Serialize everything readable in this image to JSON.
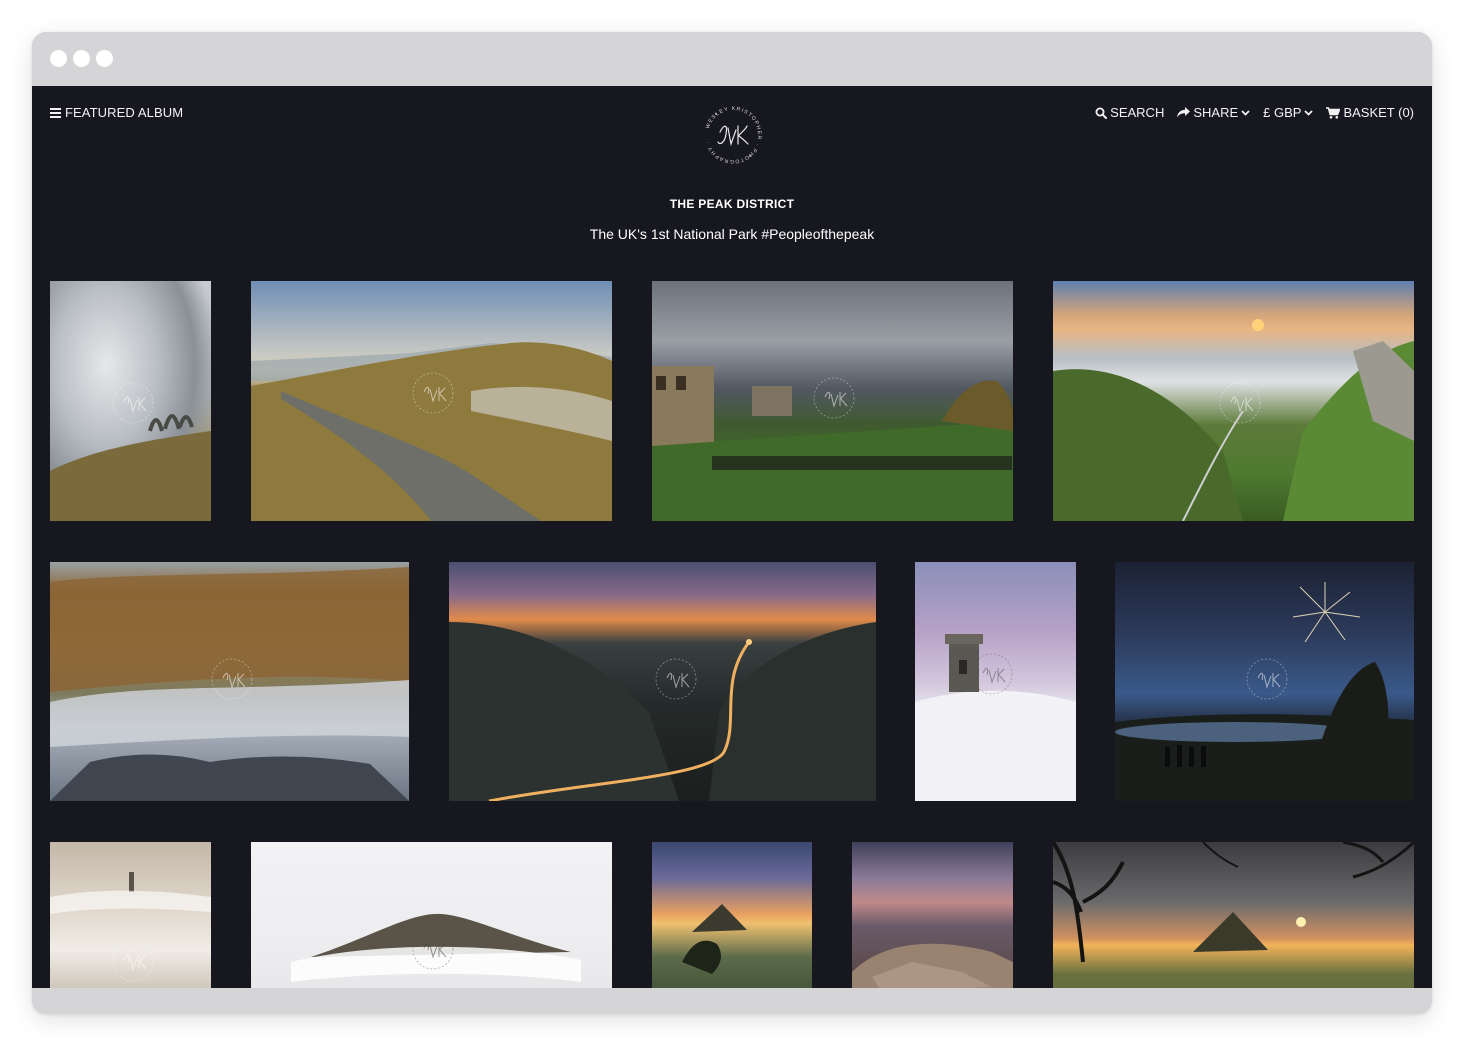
{
  "nav": {
    "menu_label": "FEATURED ALBUM",
    "search_label": "SEARCH",
    "share_label": "SHARE",
    "currency_label": "£ GBP",
    "basket_label": "BASKET (0)"
  },
  "logo": {
    "monogram": "WK",
    "ring_text": "WESLEY KRISTOPHER PHOTOGRAPHY"
  },
  "album": {
    "title": "THE PEAK DISTRICT",
    "subtitle": "The UK's 1st National Park #Peopleofthepeak"
  },
  "colors": {
    "page_background": "#17171f",
    "browser_chrome": "#d5d5d7",
    "text": "#f2f2f2"
  },
  "photos": [
    {
      "subject": "misty hillside with trees"
    },
    {
      "subject": "stone path along ridge above cloud inversion"
    },
    {
      "subject": "ruined hall and walled garden under stormy sky"
    },
    {
      "subject": "valley at sunrise above fog"
    },
    {
      "subject": "valley with morning mist"
    },
    {
      "subject": "winding road through valley at dusk"
    },
    {
      "subject": "stone tower on snowy hill"
    },
    {
      "subject": "fireworks over lake and hall at night"
    },
    {
      "subject": "tower rising above sea of cloud"
    },
    {
      "subject": "hill peak emerging from fog"
    },
    {
      "subject": "sunset behind pointed hill"
    },
    {
      "subject": "gritstone edge at dusk"
    },
    {
      "subject": "sunrise framed by bare tree branches"
    }
  ]
}
